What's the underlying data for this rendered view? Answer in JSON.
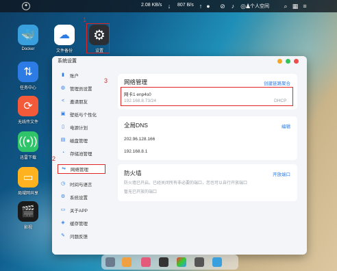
{
  "topbar": {
    "down_speed": "2.08 KB/s",
    "up_speed": "807 B/s",
    "user": "个人空间"
  },
  "desktop": {
    "icons": [
      {
        "label": "Docker"
      },
      {
        "label": "文件备份"
      },
      {
        "label": "设置"
      },
      {
        "label": "任务中心"
      },
      {
        "label": "无线传文件"
      },
      {
        "label": "迅雷下载"
      },
      {
        "label": "局域网共享"
      },
      {
        "label": "影视"
      }
    ]
  },
  "annotations": {
    "n1": "1",
    "n2": "2",
    "n3": "3"
  },
  "window": {
    "title": "系统设置",
    "sidebar": [
      {
        "label": "账户",
        "icon": "user-icon"
      },
      {
        "label": "管理员设置",
        "icon": "admin-icon"
      },
      {
        "label": "邀请朋友",
        "icon": "share-icon"
      },
      {
        "label": "壁纸与个性化",
        "icon": "wallpaper-icon"
      },
      {
        "label": "电源计划",
        "icon": "power-icon"
      },
      {
        "label": "磁盘管理",
        "icon": "disk-icon"
      },
      {
        "label": "存储池管理",
        "icon": "storage-pool-icon"
      },
      {
        "label": "网络管理",
        "icon": "network-icon"
      },
      {
        "label": "时间与语言",
        "icon": "clock-icon"
      },
      {
        "label": "系统设置",
        "icon": "system-icon"
      },
      {
        "label": "关于APP",
        "icon": "about-icon"
      },
      {
        "label": "缓存管理",
        "icon": "cache-icon"
      },
      {
        "label": "问题反馈",
        "icon": "feedback-icon"
      }
    ],
    "network": {
      "title": "网络管理",
      "create_link": "创建链路聚合",
      "nic_name": "网卡1 enp4s0",
      "nic_ip": "192.168.8.73/24",
      "nic_mode": "DHCP"
    },
    "dns": {
      "title": "全局DNS",
      "edit": "编辑",
      "server1": "202.96.128.166",
      "server2": "192.168.8.1"
    },
    "firewall": {
      "title": "防火墙",
      "open_port": "开放端口",
      "desc": "防火墙已开启。已经关闭所有非必要的端口，您也可以自行开放端口",
      "empty": "暂无已开放的端口"
    }
  },
  "colors": {
    "accent": "#2d7be5",
    "annotation": "#e02424"
  }
}
